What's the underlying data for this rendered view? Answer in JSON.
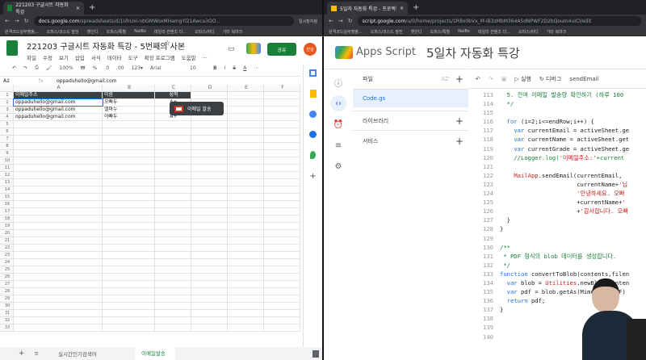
{
  "left_window": {
    "tab_title": "221203 구글시트 자동화 특강",
    "url_domain": "docs.google.com",
    "url_path": "/spreadsheets/d/1UhUxl-nbGMWoxMHamgYl21Awca3OO...",
    "profile": "일시정지됨",
    "bookmarks": [
      "원격코드실무캠핑...",
      "오피스/코스드 발전",
      "챗인디",
      "오피스/특별",
      "NaiBo",
      "데일리 컨텐츠 다...",
      "오피스/비디",
      "기타 북마크"
    ],
    "doc_title": "221203 구글시트 자동화 특강 - 5번째의 사본",
    "menu": [
      "파일",
      "수정",
      "보기",
      "삽입",
      "서식",
      "데이터",
      "도구",
      "확장 프로그램",
      "도움말",
      "..."
    ],
    "share_label": "공유",
    "avatar": "진강",
    "toolbar": {
      "zoom": "100%",
      "currency": "₩",
      "percent": "%",
      "dec1": ".0",
      "dec2": ".00",
      "format": "123▾",
      "font": "Arial",
      "size": "10"
    },
    "name_box": "A2",
    "formula": "oppaduhello@gmail.com",
    "columns": [
      "A",
      "B",
      "C",
      "D",
      "E",
      "F"
    ],
    "rows": [
      [
        "이메일주소",
        "이름",
        "성적"
      ],
      [
        "oppaduhello@gmail.com",
        "오빠두",
        "A+"
      ],
      [
        "oppaduhello@gmail.com",
        "엘마누",
        "A+"
      ],
      [
        "oppaduhello@gmail.com",
        "야빠두",
        "A+"
      ]
    ],
    "row_numbers": [
      "1",
      "2",
      "3",
      "4",
      "5",
      "6",
      "7",
      "8",
      "9",
      "10",
      "11",
      "12",
      "13",
      "14",
      "15",
      "16",
      "17",
      "18",
      "19",
      "20",
      "21",
      "22",
      "23",
      "24",
      "25",
      "26",
      "27",
      "28",
      "29",
      "30",
      "31",
      "32",
      "33"
    ],
    "email_button": "이메일 발송",
    "sheet_tabs": [
      "실시간인기검색어",
      "이메일발송"
    ]
  },
  "right_window": {
    "tab_title": "5일차 자동화 특강 - 프로젝트 편집기",
    "url_domain": "script.google.com",
    "url_path": "/u/0/home/projects/1R8x0bVx_M-iB3zMbM364A5dNPWF2D2bQoum4uiCl/edit",
    "app_name": "Apps Script",
    "project": "5일차 자동화 특강",
    "files_label": "파일",
    "file": "Code.gs",
    "libraries": "라이브러리",
    "services": "서비스",
    "run": "실행",
    "debug": "디버그",
    "function": "sendEmail",
    "code": [
      {
        "n": "113",
        "t": "  5. 전여 이메일 발송량 확인하기 (하루 100"
      },
      {
        "n": "114",
        "t": "  */"
      },
      {
        "n": "115",
        "t": ""
      },
      {
        "n": "116",
        "t": "  for (i=2;i<=endRow;i++) {"
      },
      {
        "n": "117",
        "t": "    var currentEmail = activeSheet.ge"
      },
      {
        "n": "118",
        "t": "    var currentName = activeSheet.get"
      },
      {
        "n": "119",
        "t": "    var currentGrade = activeSheet.ge"
      },
      {
        "n": "120",
        "t": "    //Logger.log('이메일주소:'+current"
      },
      {
        "n": "121",
        "t": ""
      },
      {
        "n": "122",
        "t": "    MailApp.sendEmail(currentEmail,"
      },
      {
        "n": "123",
        "t": "                      currentName+'님"
      },
      {
        "n": "124",
        "t": "                      '안녕하세요. 오빠"
      },
      {
        "n": "125",
        "t": "                      +currentName+'"
      },
      {
        "n": "126",
        "t": "                      +'감사합니다. 오빠"
      },
      {
        "n": "127",
        "t": "  }"
      },
      {
        "n": "128",
        "t": "}"
      },
      {
        "n": "129",
        "t": ""
      },
      {
        "n": "130",
        "t": "/**"
      },
      {
        "n": "131",
        "t": " * PDF 형식의 blob 데이터를 생성합니다."
      },
      {
        "n": "132",
        "t": " */"
      },
      {
        "n": "133",
        "t": "function convertToBlob(contents,filen"
      },
      {
        "n": "134",
        "t": "  var blob = Utilities.newBlob(conten"
      },
      {
        "n": "135",
        "t": "  var pdf = blob.getAs(MimeType.PDF)"
      },
      {
        "n": "136",
        "t": "  return pdf;"
      },
      {
        "n": "137",
        "t": "}"
      },
      {
        "n": "138",
        "t": ""
      },
      {
        "n": "139",
        "t": ""
      },
      {
        "n": "140",
        "t": ""
      }
    ]
  },
  "colors": {
    "sheets_green": "#188038",
    "header_dark": "#3c4043",
    "accent_blue": "#1a73e8",
    "selected_file": "#e8f0fe"
  }
}
